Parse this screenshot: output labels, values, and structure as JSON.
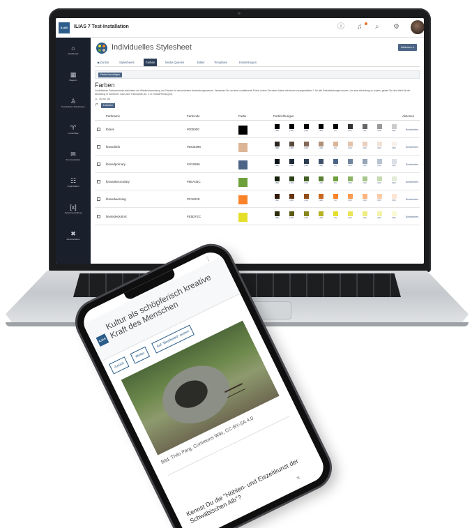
{
  "laptop": {
    "app_title": "ILIAS 7 Test-Installation",
    "logo_text": "ILIAS",
    "sidebar": [
      {
        "label": "Dashboard",
        "icon": "dashboard-icon",
        "glyph": "⌂"
      },
      {
        "label": "Magazin",
        "icon": "repository-icon",
        "glyph": "▦"
      },
      {
        "label": "Persönlicher Arbeitsraum",
        "icon": "workspace-icon",
        "glyph": "♙"
      },
      {
        "label": "Lernerfolge",
        "icon": "achievements-icon",
        "glyph": "♈"
      },
      {
        "label": "Kommunikation",
        "icon": "communication-icon",
        "glyph": "✉"
      },
      {
        "label": "Organisation",
        "icon": "organisation-icon",
        "glyph": "☷"
      },
      {
        "label": "Systemverwaltung",
        "icon": "system-admin-icon",
        "glyph": "[x]"
      },
      {
        "label": "Administration",
        "icon": "administration-icon",
        "glyph": "✖"
      }
    ],
    "page_title": "Individuelles Stylesheet",
    "actions_label": "Aktionen ▾",
    "tabs": [
      "◀ Zurück",
      "Stylesheets",
      "Farben",
      "Media Queries",
      "Bilder",
      "Templates",
      "Einstellungen"
    ],
    "active_tab": "Farben",
    "add_color_label": "Farbe hinzufügen",
    "section_title": "Farben",
    "section_description": "Vordefinierte Farbschemata erleichtern die Wiederverwendung von Farben für verschiedene Anwendungszwecke. Verweisen Sie auf eine vordefinierte Farbe, indem Sie deren Name mit einem vorangestellten '!' für alle Farbabstufungen nutzen. Um eine Abstufung zu nutzen, geben Sie den Wert für die Abstufung in Klammern nach dem Farbnamen an, z. B. !brandPrimary(20).",
    "row_count": "(1 - 16 von 16)",
    "delete_label": "Löschen",
    "columns": [
      "Farbname",
      "Farbcode",
      "Farbe",
      "Farbrichtungen",
      "Aktionen"
    ],
    "shade_labels": [
      "(-80)",
      "(-60)",
      "(-40)",
      "(-20)",
      "(0)",
      "(20)",
      "(40)",
      "(60)",
      "(80)"
    ],
    "edit_label": "Bearbeiten",
    "rows": [
      {
        "name": "lblack",
        "code": "#000000",
        "color": "#000000",
        "shades": [
          "#000000",
          "#000000",
          "#000000",
          "#000000",
          "#000000",
          "#333333",
          "#666666",
          "#999999",
          "#cccccc"
        ]
      },
      {
        "name": "lbrandinfo",
        "code": "#DCB496",
        "color": "#dcb496",
        "shades": [
          "#2c241e",
          "#58483c",
          "#84685a",
          "#b09078",
          "#dcb496",
          "#e3c3ab",
          "#eacfbf",
          "#f1e1d5",
          "#f8f0ea"
        ]
      },
      {
        "name": "lbrandprimary",
        "code": "#4C6586",
        "color": "#4c6586",
        "shades": [
          "#0f141b",
          "#1e2836",
          "#2e3d50",
          "#3d516b",
          "#4c6586",
          "#70849e",
          "#94a3b6",
          "#b7c1cf",
          "#dbe0e7"
        ]
      },
      {
        "name": "lbrandsecondary",
        "code": "#6EA03C",
        "color": "#6ea03c",
        "shades": [
          "#16200c",
          "#2c4018",
          "#426024",
          "#588030",
          "#6ea03c",
          "#8bb363",
          "#a8c68a",
          "#c5d9b1",
          "#e2ecd8"
        ]
      },
      {
        "name": "lbrandwarning",
        "code": "#FA8228",
        "color": "#fa8228",
        "shades": [
          "#321a08",
          "#643410",
          "#964e18",
          "#c86820",
          "#fa8228",
          "#fb9b53",
          "#fcb47e",
          "#fdcda9",
          "#fee6d4"
        ]
      },
      {
        "name": "ltextedeckolort",
        "code": "#E5DF2C",
        "color": "#e5df2c",
        "shades": [
          "#2e2d09",
          "#5c5912",
          "#89861a",
          "#b7b223",
          "#e5df2c",
          "#eae556",
          "#efec80",
          "#f5f2ab",
          "#faf9d5"
        ]
      }
    ]
  },
  "phone": {
    "logo_text": "ILIAS",
    "title": "Kultur als schöpferisch kreative Kraft des Menschen",
    "tabs": [
      "Zurück",
      "Weiter",
      "Auf \"Bearbeitet\" setzen"
    ],
    "caption": "Bild: Thilo Parg, Commons Wiki, CC-BY-SA 4.0",
    "question": "Kennst Du die \"Höhlen- und Eiszeitkunst der Schwäbischen Alb\"?",
    "close_glyph": "✕"
  }
}
